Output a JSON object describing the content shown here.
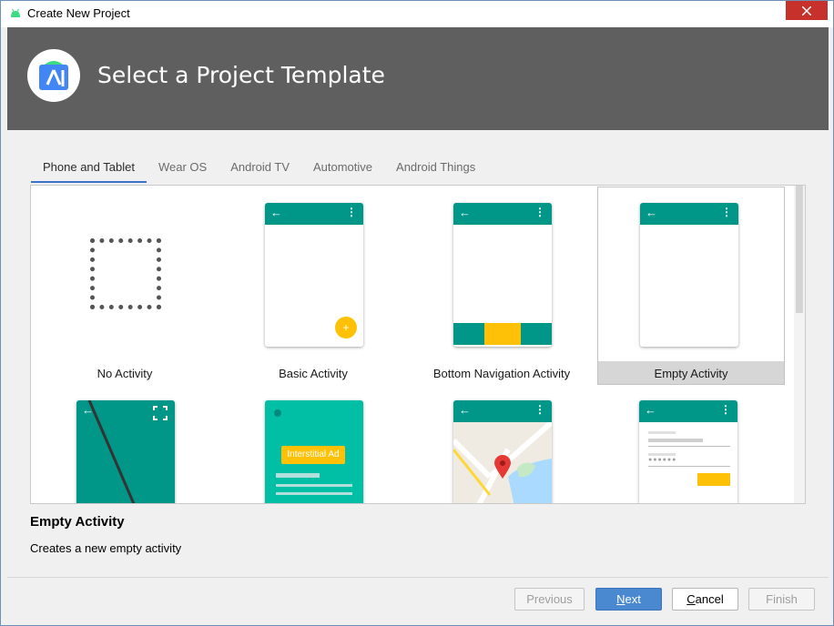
{
  "window": {
    "title": "Create New Project"
  },
  "header": {
    "heading": "Select a Project Template"
  },
  "tabs": [
    {
      "label": "Phone and Tablet",
      "active": true
    },
    {
      "label": "Wear OS",
      "active": false
    },
    {
      "label": "Android TV",
      "active": false
    },
    {
      "label": "Automotive",
      "active": false
    },
    {
      "label": "Android Things",
      "active": false
    }
  ],
  "templates": [
    {
      "label": "No Activity"
    },
    {
      "label": "Basic Activity"
    },
    {
      "label": "Bottom Navigation Activity"
    },
    {
      "label": "Empty Activity",
      "selected": true
    },
    {
      "label": ""
    },
    {
      "label": "",
      "badge": "Interstitial Ad"
    },
    {
      "label": ""
    },
    {
      "label": ""
    }
  ],
  "description": {
    "title": "Empty Activity",
    "text": "Creates a new empty activity"
  },
  "buttons": {
    "previous": "Previous",
    "next_mnemonic": "N",
    "next_rest": "ext",
    "cancel_mnemonic": "C",
    "cancel_rest": "ancel",
    "finish": "Finish"
  },
  "colors": {
    "accent": "#009688",
    "header_bg": "#5f5f5f",
    "primary_button": "#4a88d0",
    "fab": "#ffc107",
    "selected_tile": "#d6d6d6"
  }
}
